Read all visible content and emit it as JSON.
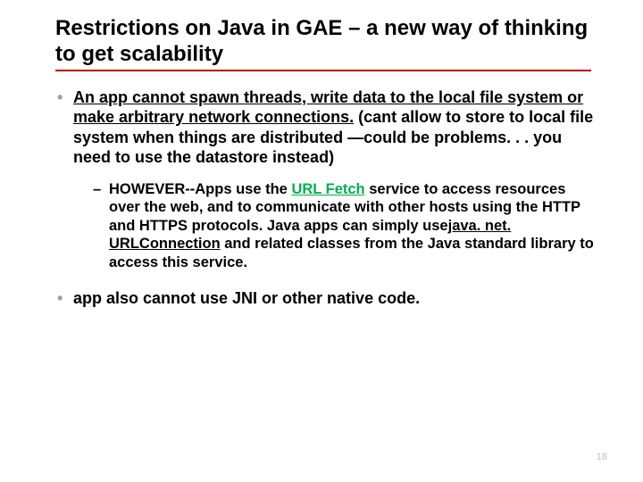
{
  "title": "Restrictions on Java in GAE – a new way of thinking to get scalability",
  "bullet1": {
    "underlined": "An app cannot spawn threads, write data to the local file system or make arbitrary network connections.",
    "rest": " (cant allow to store to local file system when things are distributed —could be problems. . . you need to use the datastore instead)",
    "sub": {
      "pre": "HOWEVER--Apps use the ",
      "link": "URL Fetch",
      "mid": " service to access resources over the web, and to communicate with other hosts using the HTTP and HTTPS protocols. Java apps can simply use",
      "code": "java. net. URLConnection",
      "post": " and related classes from the Java standard library to access this service."
    }
  },
  "bullet2": "app also cannot use JNI or other native code.",
  "page_number": "18"
}
